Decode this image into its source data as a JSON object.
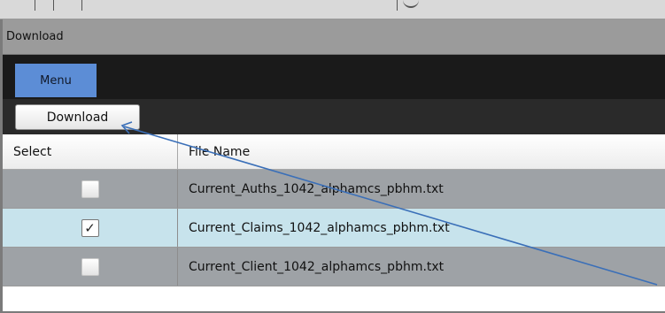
{
  "window": {
    "title": "Download"
  },
  "menu": {
    "tab_label": "Menu"
  },
  "toolbar": {
    "download_label": "Download"
  },
  "table": {
    "headers": {
      "select": "Select",
      "file_name": "File Name"
    },
    "rows": [
      {
        "file_name": "Current_Auths_1042_alphamcs_pbhm.txt",
        "checked": false,
        "check_glyph": ""
      },
      {
        "file_name": "Current_Claims_1042_alphamcs_pbhm.txt",
        "checked": true,
        "check_glyph": "✓"
      },
      {
        "file_name": "Current_Client_1042_alphamcs_pbhm.txt",
        "checked": false,
        "check_glyph": ""
      }
    ]
  },
  "colors": {
    "title_bar": "#9b9b9b",
    "menu_bar": "#1a1a1a",
    "menu_tab": "#5c8dd6",
    "row_alt": "#9ea2a6",
    "row_selected": "#c7e3ec",
    "annotation_arrow": "#3a6fb8"
  }
}
